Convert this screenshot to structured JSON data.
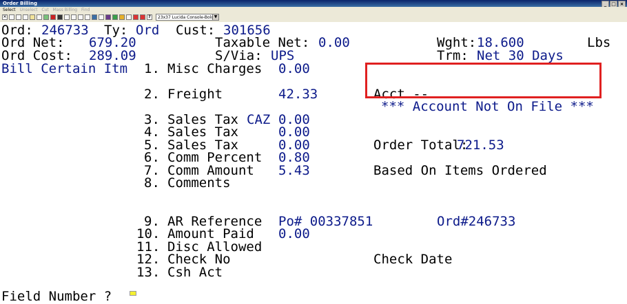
{
  "window": {
    "title": "Order Billing"
  },
  "menu": {
    "items": [
      "Select",
      "Unselect",
      "Cut",
      "Mass Billing",
      "Find"
    ]
  },
  "toolbar": {
    "font_selector": "23x37 Lucida Console-Bold"
  },
  "header": {
    "ord_label": "Ord:",
    "ord_value": "246733",
    "ty_label": "Ty:",
    "ty_value": "Ord",
    "cust_label": "Cust:",
    "cust_value": "301656",
    "net_label": "Ord Net:",
    "net_value": "679.20",
    "taxable_label": "Taxable Net:",
    "taxable_value": "0.00",
    "wght_label": "Wght:",
    "wght_value": "18.600",
    "wght_unit": "Lbs",
    "cost_label": "Ord Cost:",
    "cost_value": "289.09",
    "svia_label": "S/Via:",
    "svia_value": "UPS",
    "trm_label": "Trm:",
    "trm_value": "Net 30 Days",
    "bill_mode": "Bill Certain Itm"
  },
  "fields": [
    {
      "num": "1.",
      "label": "Misc Charges",
      "value": "0.00"
    },
    {
      "num": "2.",
      "label": "Freight",
      "value": "42.33"
    },
    {
      "num": "3.",
      "label": "Sales Tax",
      "extra": "CAZ",
      "value": "0.00"
    },
    {
      "num": "4.",
      "label": "Sales Tax",
      "value": "0.00"
    },
    {
      "num": "5.",
      "label": "Sales Tax",
      "value": "0.00"
    },
    {
      "num": "6.",
      "label": "Comm Percent",
      "value": "0.80"
    },
    {
      "num": "7.",
      "label": "Comm Amount",
      "value": "5.43"
    },
    {
      "num": "8.",
      "label": "Comments",
      "value": ""
    },
    {
      "num": "9.",
      "label": "AR Reference",
      "value": "Po# 00337851"
    },
    {
      "num": "10.",
      "label": "Amount Paid",
      "value": "0.00"
    },
    {
      "num": "11.",
      "label": "Disc Allowed",
      "value": ""
    },
    {
      "num": "12.",
      "label": "Check No",
      "value": ""
    },
    {
      "num": "13.",
      "label": "Csh Act",
      "value": ""
    }
  ],
  "account": {
    "label": "Acct --",
    "message": "*** Account Not On File ***"
  },
  "order_total": {
    "label": "Order Total:",
    "value": "721.53"
  },
  "comm_basis": "Based On Items Ordered",
  "ar_order_ref": "Ord#246733",
  "check_date_label": "Check Date",
  "prompt": {
    "label": "Field Number ?"
  },
  "colors": {
    "field_blue": "#0c1a8a",
    "alert_red": "#e02020",
    "cursor_yellow": "#f5f030"
  }
}
